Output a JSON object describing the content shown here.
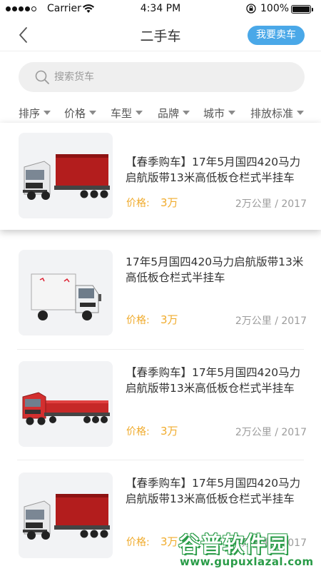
{
  "status_bar": {
    "carrier": "Carrier",
    "time": "4:34 PM",
    "battery": "100%"
  },
  "nav": {
    "title": "二手车",
    "sell_button": "我要卖车"
  },
  "search": {
    "placeholder": "搜索货车"
  },
  "filters": [
    {
      "label": "排序"
    },
    {
      "label": "价格"
    },
    {
      "label": "车型"
    },
    {
      "label": "品牌"
    },
    {
      "label": "城市"
    },
    {
      "label": "排放标准"
    }
  ],
  "listings": [
    {
      "title": "【春季购车】17年5月国四420马力启航版带13米高低板仓栏式半挂车",
      "price_label": "价格:",
      "price": "3万",
      "meta": "2万公里 / 2017",
      "image": "red-box-semi-truck"
    },
    {
      "title": "17年5月国四420马力启航版带13米高低板仓栏式半挂车",
      "price_label": "价格:",
      "price": "3万",
      "meta": "2万公里 / 2017",
      "image": "white-box-truck"
    },
    {
      "title": "【春季购车】17年5月国四420马力启航版带13米高低板仓栏式半挂车",
      "price_label": "价格:",
      "price": "3万",
      "meta": "2万公里 / 2017",
      "image": "red-flatbed-truck"
    },
    {
      "title": "【春季购车】17年5月国四420马力启航版带13米高低板仓栏式半挂车",
      "price_label": "价格:",
      "price": "3万",
      "meta": "2万公里 / 2017",
      "image": "red-box-semi-truck"
    }
  ],
  "watermark": {
    "main": "谷普软件园",
    "url": "www.gupuxlazal.com"
  },
  "colors": {
    "accent_blue": "#4aa8e8",
    "price_orange": "#f0ab2c",
    "watermark_green": "#2a9c48"
  }
}
